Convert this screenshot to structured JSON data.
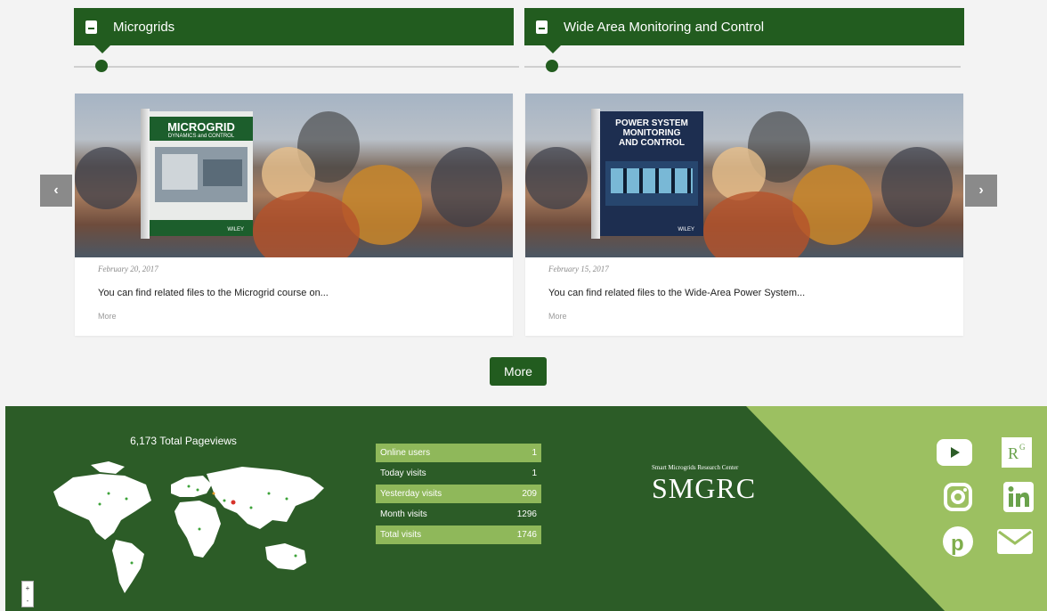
{
  "cards": [
    {
      "title": "Microgrids",
      "book": {
        "title": "MICROGRID",
        "subtitle": "DYNAMICS and CONTROL",
        "publisher": "WILEY"
      },
      "date": "February 20, 2017",
      "excerpt": "You can find related files to the Microgrid course on...",
      "more": "More"
    },
    {
      "title": "Wide Area Monitoring and Control",
      "book": {
        "title_lines": [
          "POWER SYSTEM",
          "MONITORING",
          "AND CONTROL"
        ],
        "publisher": "WILEY"
      },
      "date": "February 15, 2017",
      "excerpt": "You can find related files to the Wide-Area Power System...",
      "more": "More"
    }
  ],
  "carousel": {
    "prev_icon": "chevron-left-icon",
    "next_icon": "chevron-right-icon"
  },
  "more_button": "More",
  "footer": {
    "pageviews": "6,173 Total Pageviews",
    "stats": [
      {
        "label": "Online users",
        "value": "1",
        "highlight": true
      },
      {
        "label": "Today visits",
        "value": "1",
        "highlight": false
      },
      {
        "label": "Yesterday visits",
        "value": "209",
        "highlight": true
      },
      {
        "label": "Month visits",
        "value": "1296",
        "highlight": false
      },
      {
        "label": "Total visits",
        "value": "1746",
        "highlight": true
      }
    ],
    "brand_small": "Smart Microgrids Research Center",
    "brand": "SMGRC",
    "social_icons": [
      "youtube-icon",
      "researchgate-icon",
      "instagram-icon",
      "linkedin-icon",
      "pinterest-icon",
      "mail-icon"
    ],
    "zoom": {
      "in": "+",
      "out": "-"
    }
  },
  "colors": {
    "primary": "#225c1f",
    "footer": "#2c5c27",
    "accent": "#9cc061",
    "stat_highlight": "#8fb85a"
  }
}
